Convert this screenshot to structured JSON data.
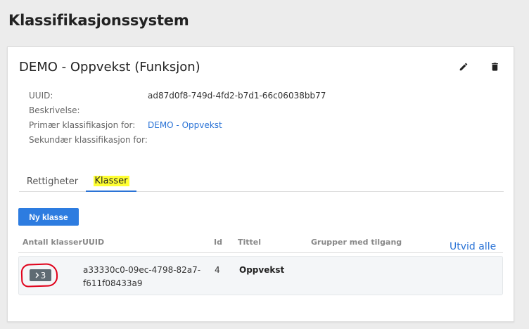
{
  "page": {
    "title": "Klassifikasjonssystem"
  },
  "card": {
    "title": "DEMO - Oppvekst (Funksjon)",
    "meta": {
      "uuid_label": "UUID:",
      "uuid_value": "ad87d0f8-749d-4fd2-b7d1-66c06038bb77",
      "description_label": "Beskrivelse:",
      "primary_label": "Primær klassifikasjon for:",
      "primary_value": "DEMO - Oppvekst",
      "secondary_label": "Sekundær klassifikasjon for:"
    },
    "icons": {
      "edit": "pencil-icon",
      "delete": "trash-icon"
    }
  },
  "tabs": [
    {
      "label": "Rettigheter",
      "active": false
    },
    {
      "label": "Klasser",
      "active": true
    }
  ],
  "toolbar": {
    "new_class_label": "Ny klasse",
    "expand_all_label": "Utvid alle"
  },
  "table": {
    "headers": [
      "Antall klasser",
      "UUID",
      "Id",
      "Tittel",
      "Grupper med tilgang"
    ],
    "rows": [
      {
        "count": "3",
        "uuid": "a33330c0-09ec-4798-82a7-f611f08433a9",
        "id": "4",
        "title": "Oppvekst",
        "groups": ""
      }
    ]
  },
  "colors": {
    "accent": "#2d7ce0",
    "link": "#2a73d6",
    "highlight": "#ffff33",
    "annotation": "#e0001a"
  }
}
